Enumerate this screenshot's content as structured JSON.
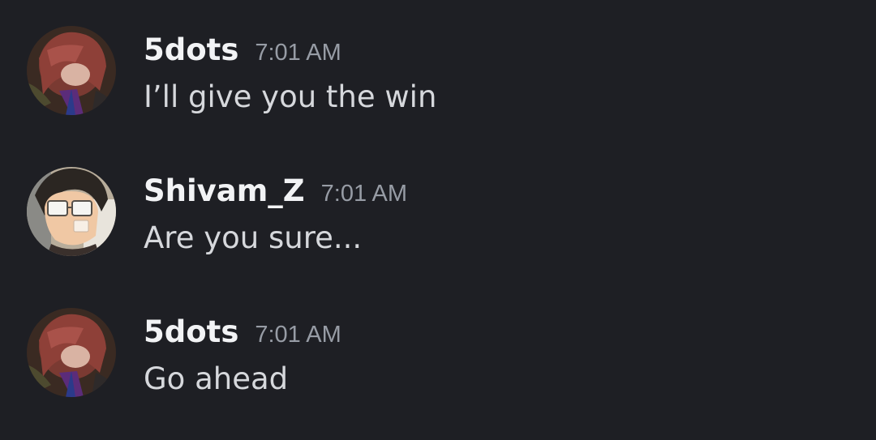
{
  "theme": {
    "background": "#1e1f24",
    "username_color": "#f2f3f5",
    "timestamp_color": "#979ca5",
    "message_color": "#d6d8dc"
  },
  "messages": [
    {
      "username": "5dots",
      "timestamp": "7:01 AM",
      "text": "I’ll give you the win",
      "avatar": "anime-avatar-red-hair"
    },
    {
      "username": "Shivam_Z",
      "timestamp": "7:01 AM",
      "text": "Are you sure...",
      "avatar": "anime-avatar-glasses"
    },
    {
      "username": "5dots",
      "timestamp": "7:01 AM",
      "text": "Go ahead",
      "avatar": "anime-avatar-red-hair"
    }
  ]
}
